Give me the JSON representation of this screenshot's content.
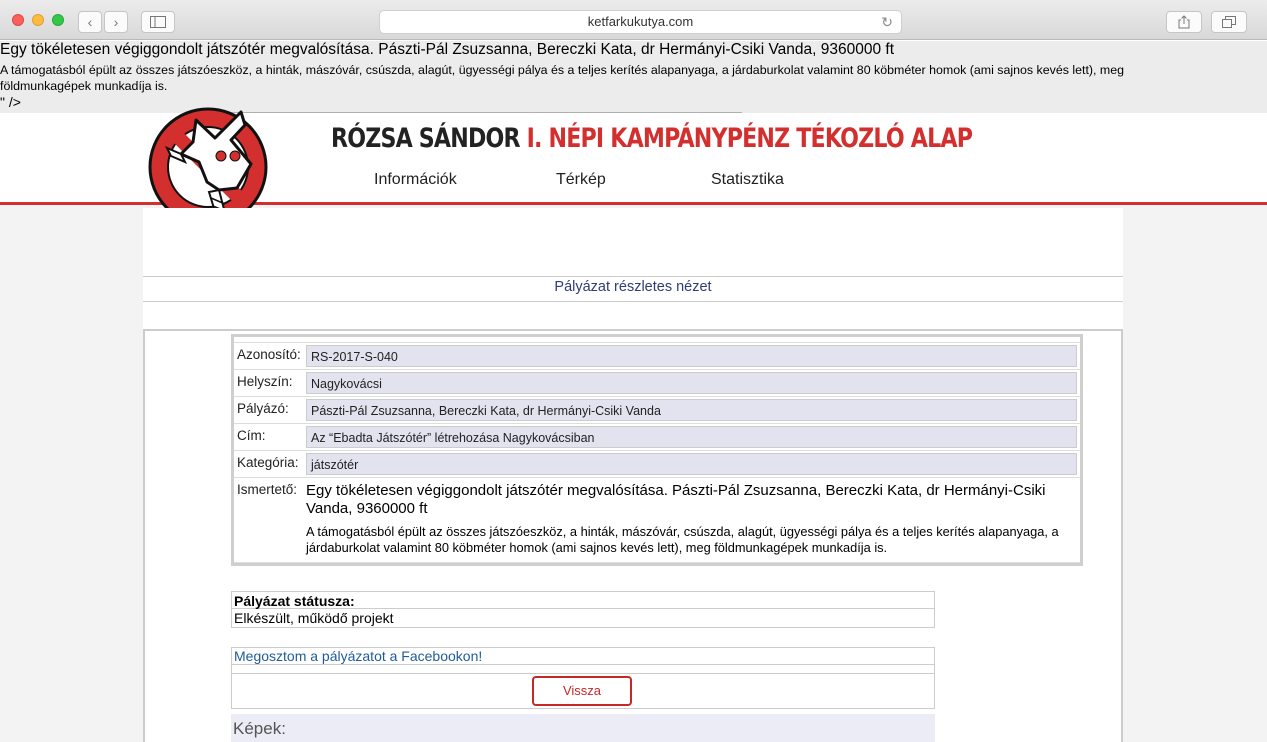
{
  "browser": {
    "url": "ketfarkukutya.com",
    "back_glyph": "‹",
    "forward_glyph": "›",
    "reload_glyph": "↻"
  },
  "leaked_meta": {
    "title": "Egy tökéletesen végiggondolt játszótér megvalósítása. Pászti-Pál Zsuzsanna, Bereczki Kata, dr Hermányi-Csiki Vanda, 9360000 ft",
    "description": "A támogatásból épült az összes játszóeszköz, a hinták, mászóvár, csúszda, alagút, ügyességi pálya és a teljes kerítés alapanyaga, a járdaburkolat valamint 80 köbméter homok (ami sajnos kevés lett), meg földmunkagépek munkadíja is.",
    "tail": "\" />"
  },
  "header": {
    "title_dark": "RÓZSA SÁNDOR",
    "title_red": "I. NÉPI KAMPÁNYPÉNZ TÉKOZLÓ ALAP",
    "nav": [
      "Információk",
      "Térkép",
      "Statisztika"
    ]
  },
  "colors": {
    "brand_red": "#d32f2f",
    "heading_blue": "#2f3b7a",
    "field_bg": "#e3e3f0"
  },
  "main": {
    "heading": "Pályázat részletes nézet",
    "fields": [
      {
        "label": "Azonosító:",
        "value": "RS-2017-S-040"
      },
      {
        "label": "Helyszín:",
        "value": "Nagykovácsi"
      },
      {
        "label": "Pályázó:",
        "value": "Pászti-Pál Zsuzsanna, Bereczki Kata, dr Hermányi-Csiki Vanda"
      },
      {
        "label": "Cím:",
        "value": "Az “Ebadta Játszótér” létrehozása Nagykovácsiban"
      },
      {
        "label": "Kategória:",
        "value": "játszótér"
      }
    ],
    "description_label": "Ismertető:",
    "description_title": "Egy tökéletesen végiggondolt játszótér megvalósítása. Pászti-Pál Zsuzsanna, Bereczki Kata, dr Hermányi-Csiki Vanda, 9360000 ft",
    "description_text": "A támogatásból épült az összes játszóeszköz, a hinták, mászóvár, csúszda, alagút, ügyességi pálya és a teljes kerítés alapanyaga, a járdaburkolat valamint 80 köbméter homok (ami sajnos kevés lett), meg földmunkagépek munkadíja is.",
    "status_label": "Pályázat státusza:",
    "status_value": "Elkészült, működő projekt",
    "share_link": "Megosztom a pályázatot a Facebookon!",
    "back_button": "Vissza",
    "images_heading": "Képek:"
  }
}
